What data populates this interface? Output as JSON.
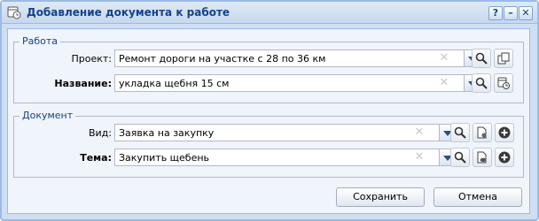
{
  "window": {
    "title": "Добавление документа к работе",
    "help": "?",
    "minimize": "–",
    "close": "✕"
  },
  "work_group": {
    "legend": "Работа",
    "project_label": "Проект:",
    "project_value": "Ремонт дороги на участке с 28 по 36 км",
    "name_label": "Название:",
    "name_value": "укладка щебня 15 см"
  },
  "document_group": {
    "legend": "Документ",
    "type_label": "Вид:",
    "type_value": "Заявка на закупку",
    "subject_label": "Тема:",
    "subject_value": "Закупить щебень"
  },
  "footer": {
    "save_label": "Сохранить",
    "cancel_label": "Отмена"
  },
  "icons": {
    "title": "calendar-clock-icon",
    "search": "magnifier-icon",
    "project_extra": "copy-document-icon",
    "name_extra": "schedule-icon",
    "type_extra": "document-settings-icon",
    "subject_extra": "document-cloud-icon",
    "add": "add-circle-icon"
  },
  "colors": {
    "accent": "#15428b",
    "frame": "#99bbe8"
  }
}
